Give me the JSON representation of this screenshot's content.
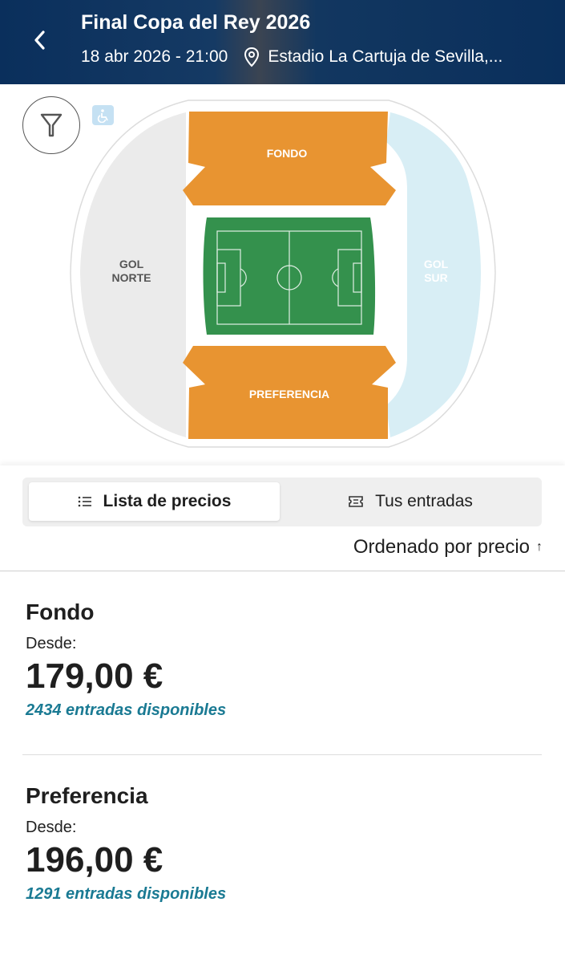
{
  "header": {
    "title": "Final Copa del Rey 2026",
    "datetime": "18 abr 2026 - 21:00",
    "venue": "Estadio La Cartuja de Sevilla,..."
  },
  "map": {
    "sectors": {
      "fondo": "FONDO",
      "preferencia": "PREFERENCIA",
      "gol_norte_1": "GOL",
      "gol_norte_2": "NORTE",
      "gol_sur_1": "GOL",
      "gol_sur_2": "SUR"
    },
    "colors": {
      "available_sector": "#e89431",
      "gol_norte": "#ebebeb",
      "gol_sur": "#d8eef5",
      "pitch": "#34914d",
      "header": "#0a2f5c",
      "accent_text": "#1a7a93"
    }
  },
  "tabs": {
    "price_list": "Lista de precios",
    "your_tickets": "Tus entradas"
  },
  "sort": {
    "label": "Ordenado por precio",
    "arrow": "↑"
  },
  "prices": [
    {
      "name": "Fondo",
      "from_label": "Desde:",
      "price": "179,00 €",
      "availability": "2434 entradas disponibles"
    },
    {
      "name": "Preferencia",
      "from_label": "Desde:",
      "price": "196,00 €",
      "availability": "1291 entradas disponibles"
    }
  ]
}
